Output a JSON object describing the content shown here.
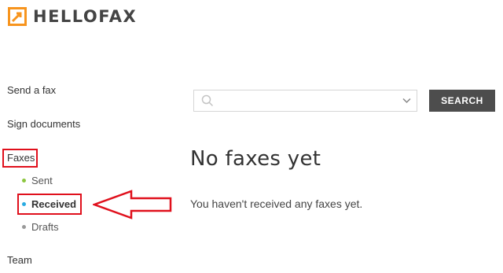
{
  "app": {
    "name": "HELLOFAX",
    "brand_color": "#f7941d"
  },
  "sidebar": {
    "items": [
      {
        "label": "Send a fax"
      },
      {
        "label": "Sign documents"
      },
      {
        "label": "Faxes"
      },
      {
        "label": "Team"
      }
    ],
    "fax_subitems": [
      {
        "label": "Sent",
        "dot_color": "#8cc63f"
      },
      {
        "label": "Received",
        "dot_color": "#29abe2",
        "active": true
      },
      {
        "label": "Drafts",
        "dot_color": "#999999"
      }
    ]
  },
  "search": {
    "value": "",
    "placeholder": "",
    "button_label": "SEARCH"
  },
  "main": {
    "title": "No faxes yet",
    "message": "You haven't received any faxes yet."
  },
  "annotation": {
    "highlight_color": "#e0101c"
  }
}
